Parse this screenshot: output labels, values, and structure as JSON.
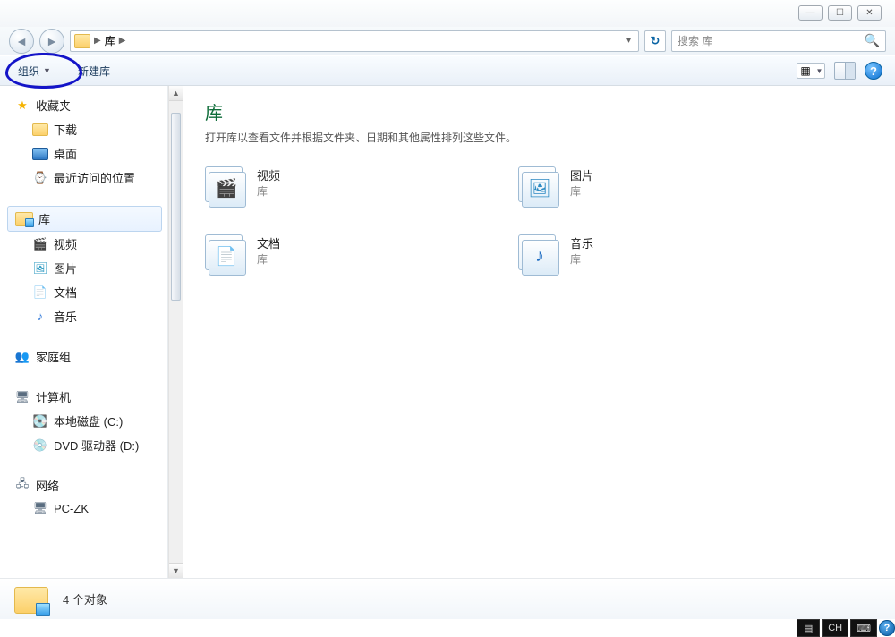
{
  "window": {
    "minimize_glyph": "—",
    "maximize_glyph": "☐",
    "close_glyph": "✕"
  },
  "nav": {
    "back_glyph": "◄",
    "forward_glyph": "►",
    "breadcrumb": {
      "root": "库"
    },
    "refresh_glyph": "↻",
    "search_placeholder": "搜索 库"
  },
  "toolbar": {
    "organize": "组织",
    "new_library": "新建库"
  },
  "sidebar": {
    "favorites": {
      "label": "收藏夹",
      "items": [
        "下载",
        "桌面",
        "最近访问的位置"
      ]
    },
    "libraries": {
      "label": "库",
      "items": [
        "视频",
        "图片",
        "文档",
        "音乐"
      ]
    },
    "homegroup": {
      "label": "家庭组"
    },
    "computer": {
      "label": "计算机",
      "items": [
        "本地磁盘 (C:)",
        "DVD 驱动器 (D:)"
      ]
    },
    "network": {
      "label": "网络",
      "items": [
        "PC-ZK"
      ]
    }
  },
  "main": {
    "title": "库",
    "subtitle": "打开库以查看文件并根据文件夹、日期和其他属性排列这些文件。",
    "kind": "库",
    "items": [
      "视频",
      "图片",
      "文档",
      "音乐"
    ]
  },
  "status": {
    "text": "4 个对象"
  },
  "langbar": {
    "ime": "CH"
  }
}
